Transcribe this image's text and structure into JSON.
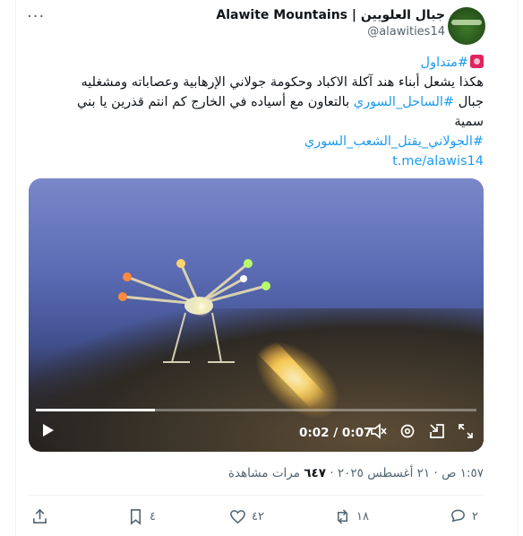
{
  "header": {
    "display_name": "Alawite Mountains | جبال العلويين",
    "handle": "@alawities14",
    "more_label": "···"
  },
  "tweet": {
    "hashtag_trending": "#متداول",
    "line1": "هكذا يشعل أبناء هند آكلة الاكباد وحكومة جولاني الإرهابية وعصاباته ومشغليه",
    "line2_start": "جبال",
    "hashtag_coast": "#الساحل_السوري",
    "line2_rest": "بالتعاون مع أسياده في الخارج كم انتم قذرين يا بني",
    "line3": "سمية",
    "hashtag_julani": "#الجولاني_يقتل_الشعب_السوري",
    "link": "t.me/alawis14"
  },
  "video": {
    "time_display": "0:02 / 0:07",
    "progress_fraction": 0.27
  },
  "meta": {
    "time": "١:٥٧ ص",
    "date": "٢١ أغسطس ٢٠٢٥",
    "views_count": "٦٤٧",
    "views_label": "مرات مشاهدة",
    "dot": "·"
  },
  "actions": {
    "replies": "٢",
    "reposts": "١٨",
    "likes": "٤٢",
    "bookmarks": "٤"
  },
  "colors": {
    "accent": "#1d9bf0",
    "muted": "#536471",
    "text": "#0f1419"
  }
}
